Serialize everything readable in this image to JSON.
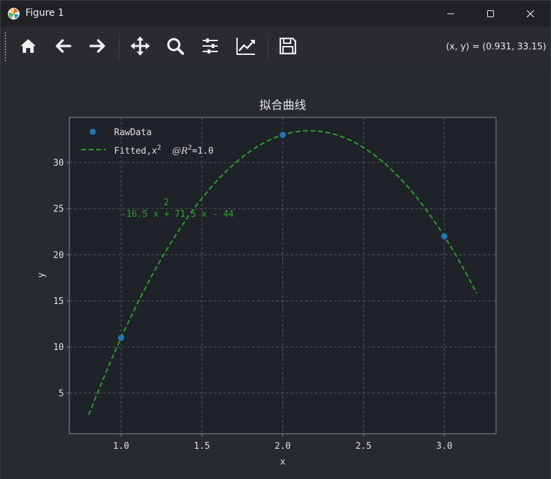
{
  "window": {
    "title": "Figure 1",
    "icon": "matplotlib-icon",
    "controls": [
      "minimize-icon",
      "maximize-icon",
      "close-icon"
    ]
  },
  "toolbar": {
    "buttons": [
      "home-icon",
      "back-arrow-icon",
      "forward-arrow-icon",
      "pan-move-icon",
      "zoom-magnifier-icon",
      "configure-subplots-icon",
      "edit-axis-curves-icon",
      "save-floppy-icon"
    ],
    "coords_readout": "(x, y) = (0.931, 33.15)"
  },
  "chart_data": {
    "type": "scatter",
    "title": "拟合曲线",
    "xlabel": "x",
    "ylabel": "y",
    "xlim": [
      0.68,
      3.32
    ],
    "ylim": [
      0.6,
      34.9
    ],
    "xticks": [
      1.0,
      1.5,
      2.0,
      2.5,
      3.0
    ],
    "xtick_labels": [
      "1.0",
      "1.5",
      "2.0",
      "2.5",
      "3.0"
    ],
    "yticks": [
      5,
      10,
      15,
      20,
      25,
      30
    ],
    "ytick_labels": [
      "5",
      "10",
      "15",
      "20",
      "25",
      "30"
    ],
    "grid": true,
    "legend_position": "upper-left",
    "series": [
      {
        "name": "RawData",
        "kind": "scatter",
        "color": "#1f77b4",
        "x": [
          1.0,
          2.0,
          3.0
        ],
        "y": [
          11.0,
          33.0,
          22.0
        ]
      },
      {
        "name": "Fitted,x",
        "name_sup": "2",
        "name_suffix_italic": "@R",
        "name_suffix_sup": "2",
        "name_suffix_tail": "=1.0",
        "kind": "line",
        "style": "dashed",
        "color": "#2ca02c",
        "coefficients": [
          -16.5,
          71.5,
          -44.0
        ],
        "x_range": [
          0.8,
          3.2
        ]
      }
    ],
    "annotation": {
      "exponent": "2",
      "text": "-16.5 x + 71.5 x - 44",
      "color": "#2ca02c",
      "x": 1.0,
      "y": 24.5
    },
    "colors": {
      "axes_bg": "#1f2228",
      "figure_bg": "#272a2f",
      "grid": "#555a60",
      "text": "#e0e0e0"
    }
  }
}
